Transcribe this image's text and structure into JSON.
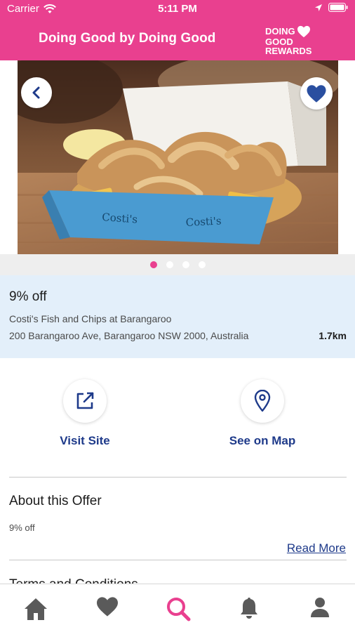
{
  "status_bar": {
    "carrier": "Carrier",
    "time": "5:11 PM"
  },
  "header": {
    "title": "Doing Good by Doing Good",
    "logo": {
      "line1": "DOING",
      "line2": "GOOD",
      "line3": "REWARDS"
    }
  },
  "carousel": {
    "page_count": 4,
    "active_page": 1
  },
  "offer": {
    "title": "9% off",
    "merchant": "Costi's Fish and Chips at Barangaroo",
    "address": "200 Barangaroo Ave, Barangaroo NSW 2000, Australia",
    "distance": "1.7km"
  },
  "actions": {
    "visit_site": "Visit Site",
    "see_on_map": "See on Map"
  },
  "about": {
    "title": "About this Offer",
    "body": "9% off",
    "read_more": "Read More"
  },
  "terms": {
    "title": "Terms and Conditions"
  },
  "tab_bar": {
    "items": [
      {
        "name": "home-icon"
      },
      {
        "name": "heart-icon"
      },
      {
        "name": "search-icon",
        "active": true
      },
      {
        "name": "bell-icon"
      },
      {
        "name": "person-icon"
      }
    ]
  },
  "colors": {
    "brand_pink": "#e9408f",
    "navy": "#1e3a8a",
    "info_background": "#e3effa",
    "inactive_icon": "#5a5a5a"
  }
}
